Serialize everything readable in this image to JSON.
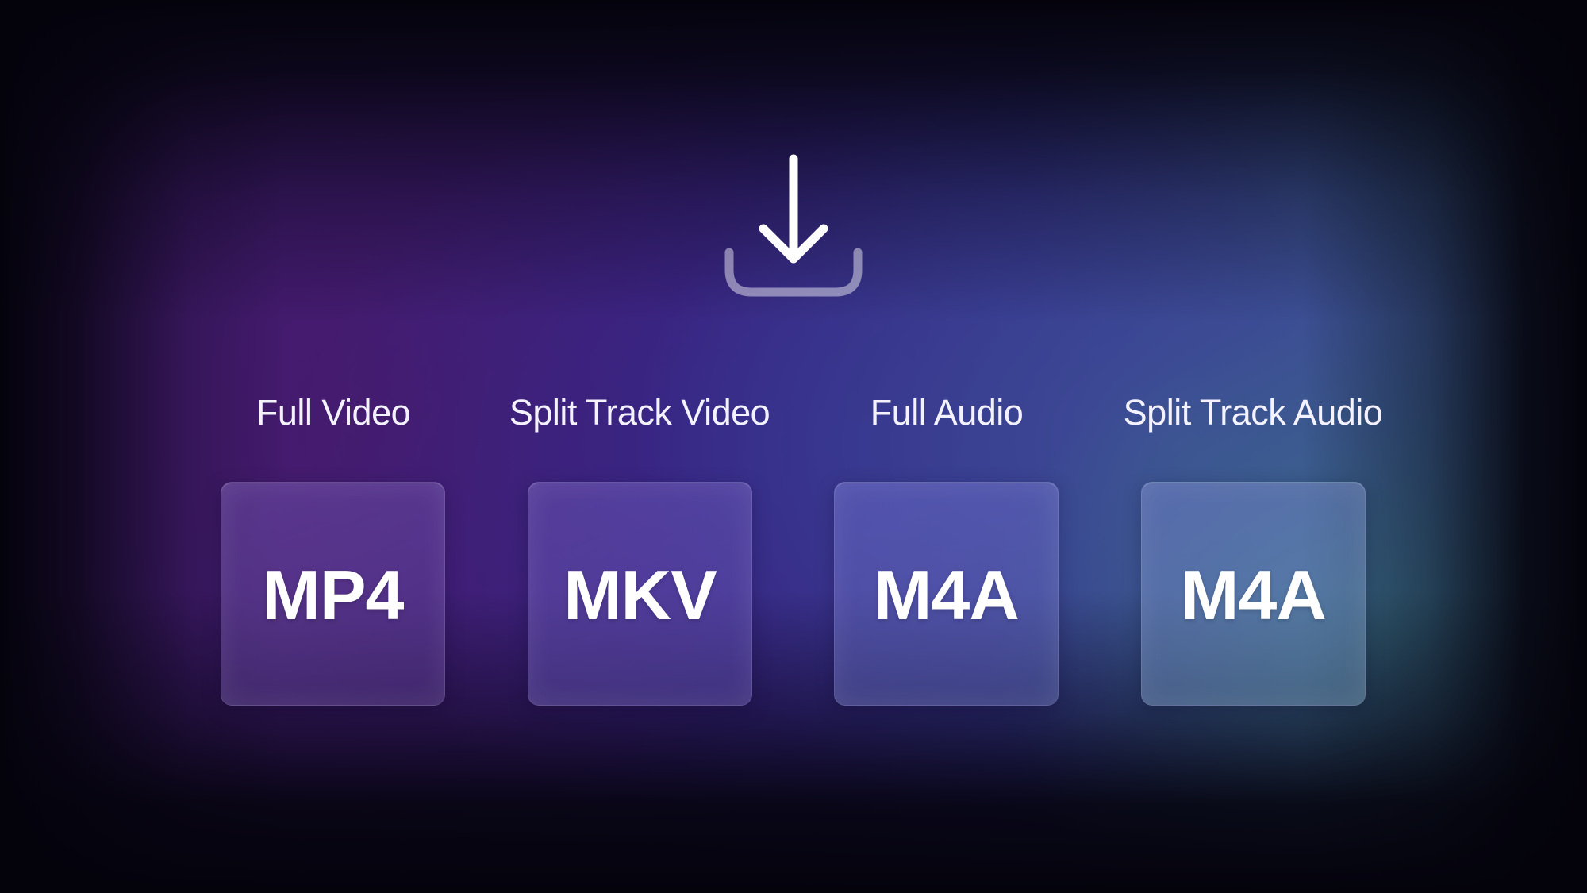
{
  "icon": {
    "name": "download-icon",
    "arrow_color": "#ffffff",
    "tray_color": "rgba(255,255,255,0.45)"
  },
  "options": [
    {
      "label": "Full Video",
      "format": "MP4"
    },
    {
      "label": "Split Track Video",
      "format": "MKV"
    },
    {
      "label": "Full Audio",
      "format": "M4A"
    },
    {
      "label": "Split Track Audio",
      "format": "M4A"
    }
  ],
  "colors": {
    "background_dark": "#04030c",
    "purple": "#451a6c",
    "indigo": "#352b8c",
    "blue": "#3c4f92",
    "teal": "#3a6b85",
    "text": "#ffffff"
  }
}
